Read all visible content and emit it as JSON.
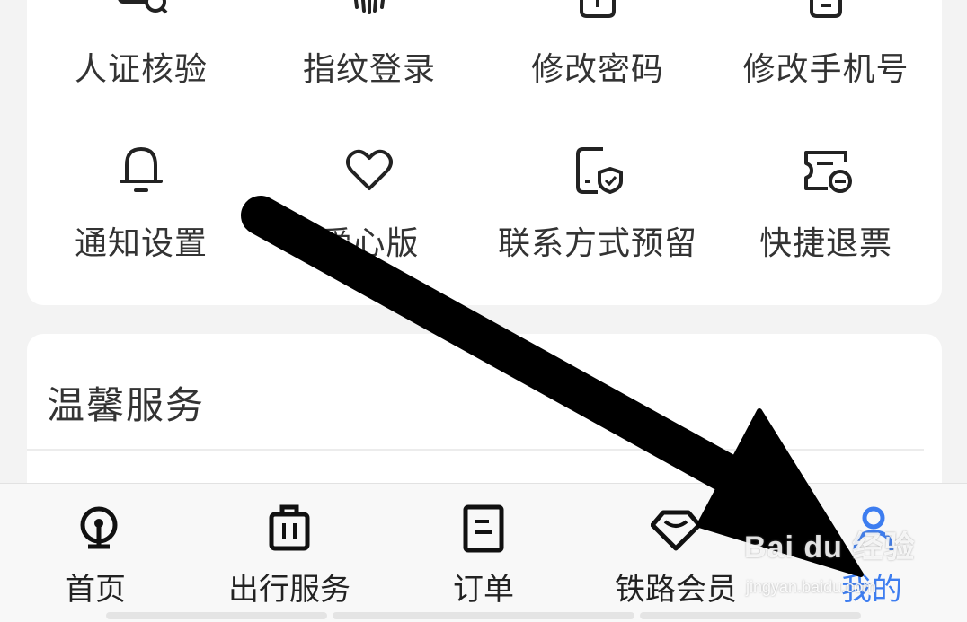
{
  "account_grid": {
    "row1": [
      {
        "label": "人证核验",
        "icon": "face-verify-icon"
      },
      {
        "label": "指纹登录",
        "icon": "fingerprint-icon"
      },
      {
        "label": "修改密码",
        "icon": "password-icon"
      },
      {
        "label": "修改手机号",
        "icon": "phone-icon"
      }
    ],
    "row2": [
      {
        "label": "通知设置",
        "icon": "bell-icon"
      },
      {
        "label": "爱心版",
        "icon": "heart-icon"
      },
      {
        "label": "联系方式预留",
        "icon": "contact-shield-icon"
      },
      {
        "label": "快捷退票",
        "icon": "ticket-refund-icon"
      }
    ]
  },
  "warm_service": {
    "title": "温馨服务"
  },
  "tabbar": {
    "tabs": [
      {
        "label": "首页",
        "icon": "railway-logo-icon"
      },
      {
        "label": "出行服务",
        "icon": "luggage-icon"
      },
      {
        "label": "订单",
        "icon": "order-icon"
      },
      {
        "label": "铁路会员",
        "icon": "diamond-icon"
      },
      {
        "label": "我的",
        "icon": "person-icon",
        "active": true
      }
    ]
  },
  "colors": {
    "accent": "#3d7df0",
    "arrow": "#000000"
  },
  "watermark": {
    "brand": "Bai du 经验",
    "sub": "jingyan.baidu.com"
  }
}
